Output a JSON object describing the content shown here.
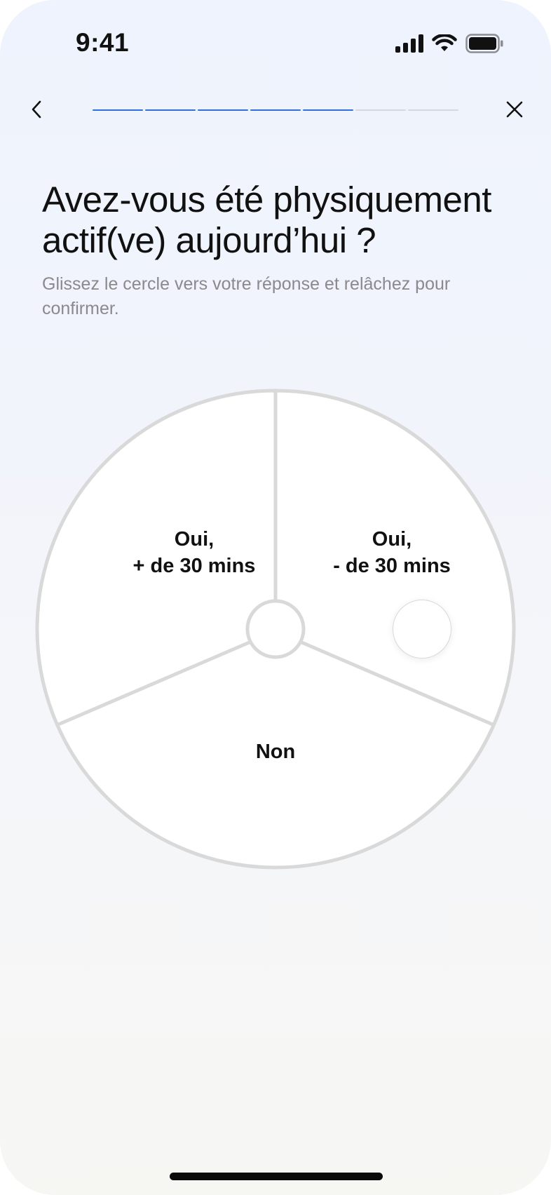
{
  "status_bar": {
    "time": "9:41",
    "icons": [
      "signal-icon",
      "wifi-icon",
      "battery-icon"
    ]
  },
  "nav": {
    "back_icon": "chevron-left-icon",
    "close_icon": "close-icon",
    "progress": {
      "total_steps": 7,
      "completed_steps": 5,
      "active_color": "#2f6fe0",
      "inactive_color": "#d6d8dd"
    }
  },
  "question": {
    "title": "Avez-vous été physiquement actif(ve) aujourd’hui ?",
    "subtitle": "Glissez le cercle vers votre réponse et relâchez pour confirmer."
  },
  "wheel": {
    "options": [
      {
        "line1": "Oui,",
        "line2": "+ de 30 mins"
      },
      {
        "line1": "Oui,",
        "line2": "- de 30 mins"
      },
      {
        "line1": "Non",
        "line2": ""
      }
    ],
    "border_color": "#d9d9d9",
    "fill_color": "#ffffff"
  }
}
